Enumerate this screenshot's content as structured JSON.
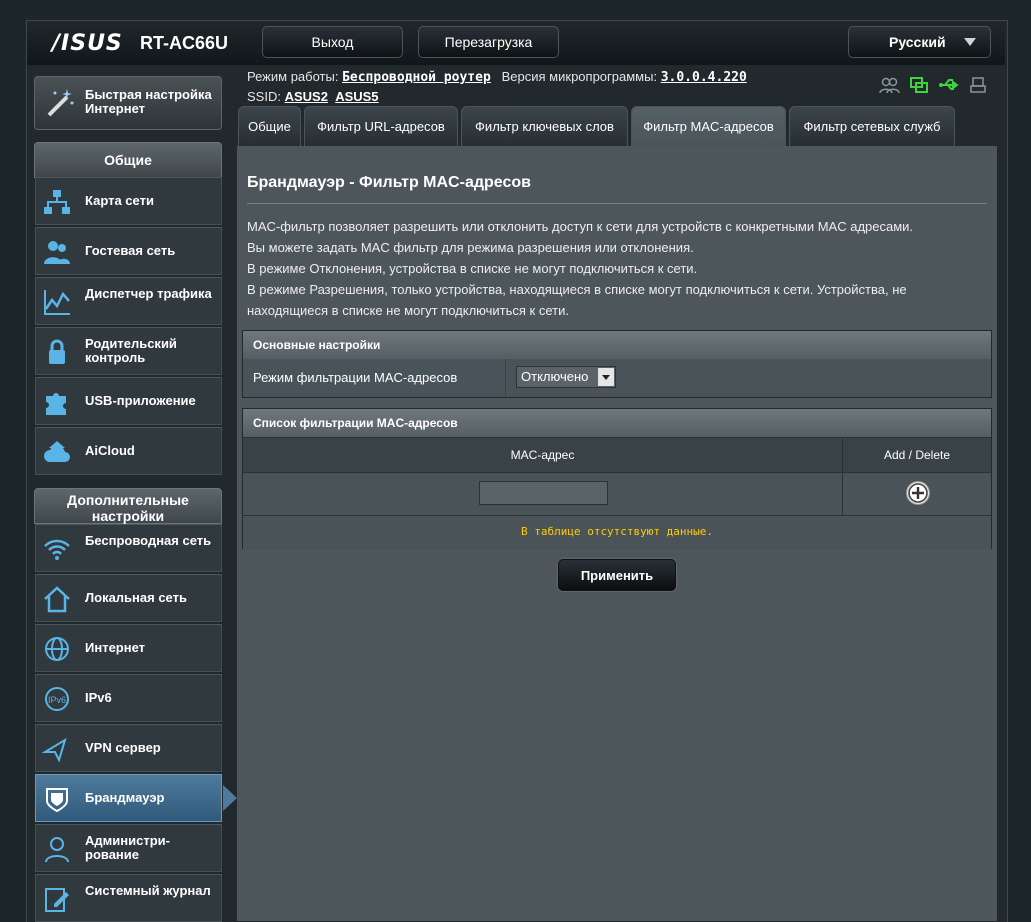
{
  "header": {
    "logo": "/ISUS",
    "model": "RT-AC66U",
    "logout": "Выход",
    "reboot": "Перезагрузка",
    "language": "Русский"
  },
  "info": {
    "mode_label": "Режим работы:",
    "mode_value": "Беспроводной роутер",
    "fw_label": "Версия микропрограммы:",
    "fw_value": "3.0.0.4.220",
    "ssid_label": "SSID:",
    "ssid1": "ASUS2",
    "ssid2": "ASUS5"
  },
  "sidebar": {
    "qis_label": "Быстрая настройка Интернет",
    "general_head": "Общие",
    "general_items": [
      {
        "label": "Карта сети",
        "icon": "network-map-icon"
      },
      {
        "label": "Гостевая сеть",
        "icon": "guest-network-icon"
      },
      {
        "label": "Диспетчер трафика",
        "icon": "traffic-manager-icon"
      },
      {
        "label": "Родительский контроль",
        "icon": "parental-control-icon"
      },
      {
        "label": "USB-приложение",
        "icon": "usb-app-icon"
      },
      {
        "label": "AiCloud",
        "icon": "aicloud-icon"
      }
    ],
    "advanced_head": "Дополнительные настройки",
    "advanced_items": [
      {
        "label": "Беспроводная сеть",
        "icon": "wireless-icon"
      },
      {
        "label": "Локальная сеть",
        "icon": "lan-icon"
      },
      {
        "label": "Интернет",
        "icon": "internet-icon"
      },
      {
        "label": "IPv6",
        "icon": "ipv6-icon"
      },
      {
        "label": "VPN сервер",
        "icon": "vpn-icon"
      },
      {
        "label": "Брандмауэр",
        "icon": "firewall-icon",
        "active": true
      },
      {
        "label": "Администри-рование",
        "icon": "admin-icon"
      },
      {
        "label": "Системный журнал",
        "icon": "syslog-icon"
      }
    ]
  },
  "tabs": [
    "Общие",
    "Фильтр URL-адресов",
    "Фильтр ключевых слов",
    "Фильтр MAC-адресов",
    "Фильтр сетевых служб"
  ],
  "main": {
    "title": "Брандмауэр - Фильтр MAC-адресов",
    "desc": [
      "MAC-фильтр позволяет разрешить или отклонить доступ к сети для устройств с конкретными MAC адресами.",
      "Вы можете задать MAC фильтр для режима разрешения или отклонения.",
      "В режиме Отклонения, устройства в списке не могут подключиться к сети.",
      "В режиме Разрешения, только устройства, находящиеся в списке могут подключиться к сети. Устройства, не",
      "находящиеся в списке не могут подключиться к сети."
    ],
    "basic_head": "Основные настройки",
    "filter_mode_label": "Режим фильтрации MAC-адресов",
    "filter_mode_value": "Отключено",
    "list_head": "Список фильтрации MAC-адресов",
    "col_mac": "MAC-адрес",
    "col_action": "Add / Delete",
    "mac_input_value": "",
    "empty_text": "В таблице отсутствуют данные.",
    "apply": "Применить"
  }
}
